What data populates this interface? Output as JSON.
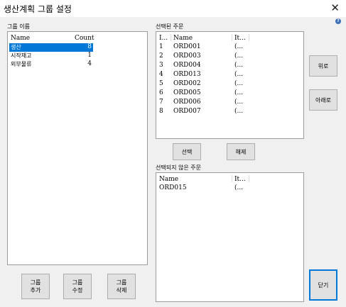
{
  "window": {
    "title": "생산계획 그룹 설정",
    "close_symbol": "✕",
    "help_symbol": "?"
  },
  "group_panel": {
    "label": "그룹 이름",
    "columns": {
      "name": "Name",
      "count": "Count"
    },
    "rows": [
      {
        "name": "생산",
        "count": "8",
        "selected": true
      },
      {
        "name": "시작재고",
        "count": "1",
        "selected": false
      },
      {
        "name": "외부물류",
        "count": "4",
        "selected": false
      }
    ]
  },
  "selected_orders": {
    "label": "선택된 주문",
    "columns": {
      "index": "I...",
      "name": "Name",
      "item": "It..."
    },
    "rows": [
      {
        "index": "1",
        "name": "ORD001",
        "item": "(..."
      },
      {
        "index": "2",
        "name": "ORD003",
        "item": "(..."
      },
      {
        "index": "3",
        "name": "ORD004",
        "item": "(..."
      },
      {
        "index": "4",
        "name": "ORD013",
        "item": "(..."
      },
      {
        "index": "5",
        "name": "ORD002",
        "item": "(..."
      },
      {
        "index": "6",
        "name": "ORD005",
        "item": "(..."
      },
      {
        "index": "7",
        "name": "ORD006",
        "item": "(..."
      },
      {
        "index": "8",
        "name": "ORD007",
        "item": "(..."
      }
    ]
  },
  "unselected_orders": {
    "label": "선택되지 않은 주문",
    "columns": {
      "name": "Name",
      "item": "It..."
    },
    "rows": [
      {
        "name": "ORD015",
        "item": "(..."
      }
    ]
  },
  "buttons": {
    "up": "위로",
    "down": "아래로",
    "select": "선택",
    "release": "해제",
    "close": "닫기",
    "add_group_l1": "그룹",
    "add_group_l2": "추가",
    "edit_group_l1": "그룹",
    "edit_group_l2": "수정",
    "delete_group_l1": "그룹",
    "delete_group_l2": "삭제"
  },
  "colors": {
    "selection": "#0078d7",
    "focus_border": "#0078d7",
    "background": "#f0f0f0"
  }
}
